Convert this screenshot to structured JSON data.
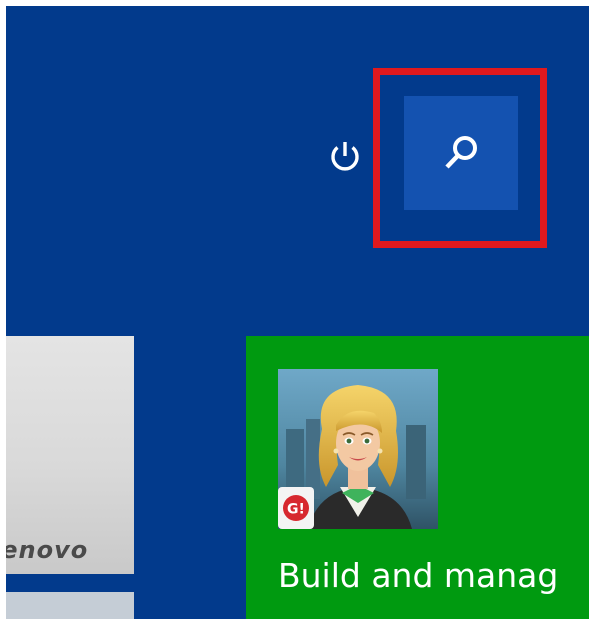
{
  "start_screen": {
    "background_color": "#023a8c",
    "power": {
      "icon": "power-icon"
    },
    "search": {
      "icon": "search-icon",
      "highlight_color": "#e0191d"
    },
    "tiles": {
      "lenovo": {
        "logo_text": "lenovo"
      },
      "app": {
        "label": "Build and manag",
        "badge_text": "G!",
        "background_color": "#009a10"
      }
    }
  }
}
